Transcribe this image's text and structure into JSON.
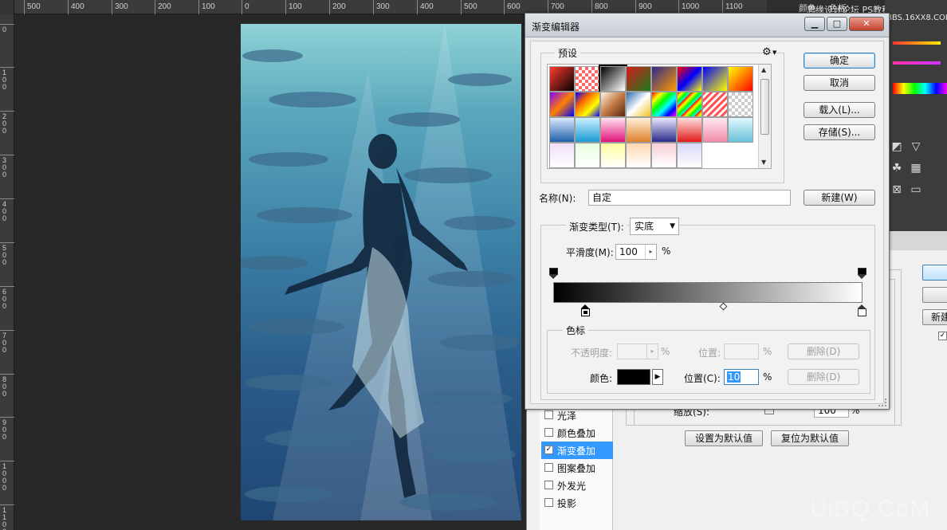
{
  "ruler": {
    "top_ticks": [
      "500",
      "400",
      "300",
      "200",
      "100",
      "0",
      "100",
      "200",
      "300",
      "400",
      "500",
      "600",
      "700",
      "800",
      "900",
      "1000",
      "1100"
    ],
    "left_ticks": [
      "0",
      "100",
      "200",
      "300",
      "400",
      "500",
      "600",
      "700",
      "800",
      "900",
      "1000",
      "1100"
    ]
  },
  "background_app": {
    "panel_tabs": [
      "颜色",
      "色板"
    ],
    "watermark_top": "思缘设计论坛  PS教程论坛",
    "watermark_url": "BBS.16XX8.COM",
    "brand": "UiBQ.CoM"
  },
  "layer_style": {
    "items": [
      {
        "label": "光泽",
        "checked": false
      },
      {
        "label": "颜色叠加",
        "checked": false
      },
      {
        "label": "渐变叠加",
        "checked": true
      },
      {
        "label": "图案叠加",
        "checked": false
      },
      {
        "label": "外发光",
        "checked": false
      },
      {
        "label": "投影",
        "checked": false
      }
    ],
    "check_mark": "✓",
    "scale_label": "缩放(S):",
    "scale_value": "100",
    "scale_unit": "%",
    "set_default_button": "设置为默认值",
    "reset_default_button": "复位为默认值",
    "new_partial": "新建"
  },
  "dialog": {
    "title": "渐变编辑器",
    "window_buttons": {
      "minimize": "▁",
      "maximize": "□",
      "close": "✕"
    },
    "presets_label": "预设",
    "gear_icon": "⚙",
    "buttons": {
      "ok": "确定",
      "cancel": "取消",
      "load": "载入(L)...",
      "save": "存储(S)...",
      "new": "新建(W)"
    },
    "name_label": "名称(N):",
    "name_value": "自定",
    "gradient_type_label": "渐变类型(T):",
    "gradient_type_value": "实底",
    "smoothness_label": "平滑度(M):",
    "smoothness_value": "100",
    "smoothness_unit": "%",
    "stops_section_label": "色标",
    "opacity_label": "不透明度:",
    "opacity_unit": "%",
    "opacity_position_label": "位置:",
    "opacity_position_unit": "%",
    "opacity_delete": "删除(D)",
    "color_label": "颜色:",
    "color_value": "#000000",
    "color_position_label": "位置(C):",
    "color_position_value": "10",
    "color_position_unit": "%",
    "color_delete": "删除(D)"
  },
  "preset_swatches": [
    "linear-gradient(135deg,#ff3b2f,#000)",
    "repeating-conic-gradient(#ff6666 0 25%, #fff 0 50%) 0 0/8px 8px",
    "linear-gradient(135deg,#000,#fff)",
    "linear-gradient(135deg,#d41d1d,#1a7a1a)",
    "linear-gradient(135deg,#2a2a8a,#ff9a00)",
    "linear-gradient(135deg,#ff0000,#0000ff,#ffff00)",
    "linear-gradient(135deg,#0000ff,#ffff00)",
    "linear-gradient(135deg,#ffff00,#ff8000,#ff0000)",
    "linear-gradient(135deg,#8000ff,#ff8000,#0000ff)",
    "linear-gradient(135deg,#0000ff,#ff6600,#ffff00,#0000ff)",
    "linear-gradient(135deg,#fff4e0,#c27a44,#5a2a10)",
    "linear-gradient(135deg,#2a6ab0,#ffffff,#f0c020)",
    "linear-gradient(135deg,#ff0000,#ffff00,#00ff00,#00ffff,#0000ff,#ff00ff)",
    "repeating-linear-gradient(135deg,#ff0000 0,#ffff00 4px,#00ff00 8px,#00ffff 12px)",
    "repeating-linear-gradient(135deg,#ff5555 0,#ff5555 3px,#ffffff 3px,#ffffff 6px)",
    "repeating-conic-gradient(#ccc 0 25%, #fff 0 50%) 0 0/8px 8px",
    "linear-gradient(180deg,#d9e9ff,#1f5fa8)",
    "linear-gradient(180deg,#c8f0ff,#1d9ad6)",
    "linear-gradient(180deg,#ffe2f0,#e0157b)",
    "linear-gradient(180deg,#fff1dc,#e0802a)",
    "linear-gradient(180deg,#e8e8ff,#2a2a8a)",
    "linear-gradient(180deg,#ffe0e0,#e01a1a)",
    "linear-gradient(180deg,#ffe8f0,#f08aa8)",
    "linear-gradient(180deg,#e0f8ff,#6ac0d8)",
    "linear-gradient(180deg,#f0e0f8,#ffffff)",
    "linear-gradient(180deg,#e8ffe0,#ffffff)",
    "linear-gradient(180deg,#ffffa0,#ffffff)",
    "linear-gradient(180deg,#ffd8b0,#ffffff)",
    "linear-gradient(180deg,#f8d0d8,#ffffff)",
    "linear-gradient(180deg,#d8d8f8,#ffffff)"
  ]
}
